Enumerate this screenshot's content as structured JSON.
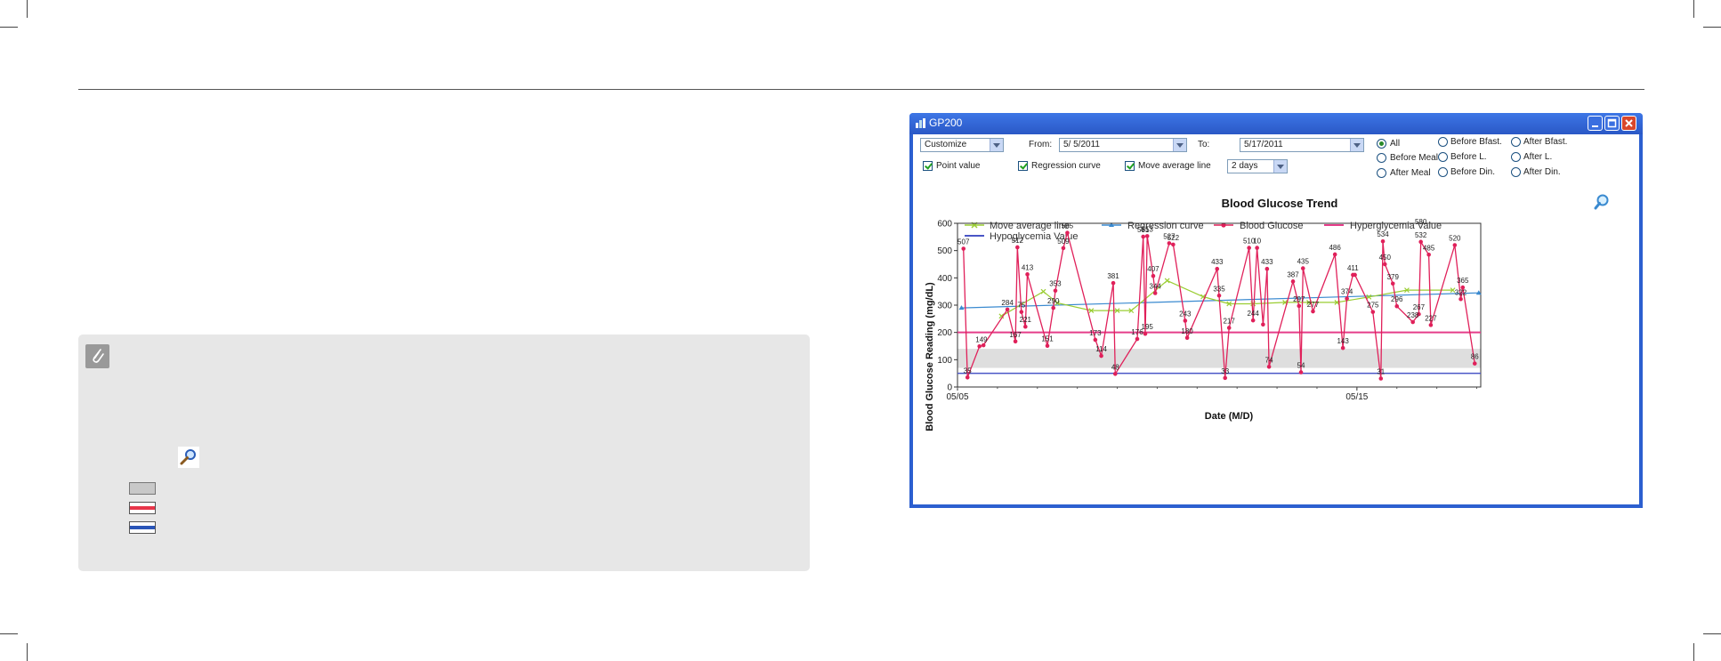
{
  "window": {
    "title": "GP200",
    "range_select": "Customize",
    "from_label": "From:",
    "from_date": "5/ 5/2011",
    "to_label": "To:",
    "to_date": "5/17/2011",
    "checkboxes": {
      "point_value": "Point value",
      "regression_curve": "Regression curve",
      "move_average_line": "Move average line"
    },
    "interval_select": "2 days",
    "meal_filters": [
      "All",
      "Before Bfast.",
      "After Bfast.",
      "Before Meal",
      "Before L.",
      "After L.",
      "After Meal",
      "Before Din.",
      "After Din."
    ],
    "selected_filter": "All"
  },
  "chart_data": {
    "type": "line",
    "title": "Blood Glucose Trend",
    "xlabel": "Date (M/D)",
    "ylabel": "Blood Glucose Reading (mg/dL)",
    "ylim": [
      0,
      600
    ],
    "yticks": [
      "0",
      "100",
      "200",
      "300",
      "400",
      "500",
      "600"
    ],
    "xticks": [
      {
        "label": "05/05",
        "day": 5
      },
      {
        "label": "05/15",
        "day": 15
      }
    ],
    "xlim_days": [
      5,
      18.1
    ],
    "legend": [
      "Move average line",
      "Regression curve",
      "Blood Glucose",
      "Hyperglycemia Value",
      "Hypoglycemia Value"
    ],
    "hyperglycemia_value": 200,
    "hypoglycemia_value": 50,
    "target_band": [
      70,
      140
    ],
    "colors": {
      "glucose": "#e0205a",
      "moving_average": "#9acd32",
      "regression": "#3a8ad0",
      "hyper": "#e53d8a",
      "hypo": "#4a56c6",
      "band": "#dedede"
    },
    "series": [
      {
        "name": "Blood Glucose",
        "points": [
          [
            5.15,
            507
          ],
          [
            5.25,
            35
          ],
          [
            5.55,
            149
          ],
          [
            5.65,
            153
          ],
          [
            6.25,
            284
          ],
          [
            6.45,
            167
          ],
          [
            6.5,
            512
          ],
          [
            6.6,
            275
          ],
          [
            6.7,
            221
          ],
          [
            6.75,
            413
          ],
          [
            7.25,
            151
          ],
          [
            7.4,
            290
          ],
          [
            7.45,
            353
          ],
          [
            7.65,
            509
          ],
          [
            7.75,
            565
          ],
          [
            8.45,
            173
          ],
          [
            8.6,
            114
          ],
          [
            8.9,
            381
          ],
          [
            8.95,
            48
          ],
          [
            9.5,
            176
          ],
          [
            9.65,
            551
          ],
          [
            9.7,
            195
          ],
          [
            9.75,
            553
          ],
          [
            9.9,
            407
          ],
          [
            9.95,
            344
          ],
          [
            10.3,
            527
          ],
          [
            10.4,
            522
          ],
          [
            10.7,
            243
          ],
          [
            10.75,
            180
          ],
          [
            11.5,
            433
          ],
          [
            11.55,
            335
          ],
          [
            11.7,
            33
          ],
          [
            11.8,
            217
          ],
          [
            12.3,
            510
          ],
          [
            12.4,
            244
          ],
          [
            12.5,
            510
          ],
          [
            12.65,
            229
          ],
          [
            12.75,
            433
          ],
          [
            12.8,
            74
          ],
          [
            13.4,
            387
          ],
          [
            13.55,
            297
          ],
          [
            13.6,
            54
          ],
          [
            13.65,
            435
          ],
          [
            13.9,
            277
          ],
          [
            14.45,
            486
          ],
          [
            14.65,
            143
          ],
          [
            14.75,
            324
          ],
          [
            14.9,
            411
          ],
          [
            14.95,
            411
          ],
          [
            15.4,
            275
          ],
          [
            15.6,
            31
          ],
          [
            15.65,
            534
          ],
          [
            15.7,
            450
          ],
          [
            15.9,
            379
          ],
          [
            16.0,
            296
          ],
          [
            16.4,
            238
          ],
          [
            16.55,
            267
          ],
          [
            16.6,
            532
          ],
          [
            16.8,
            485
          ],
          [
            16.85,
            227
          ],
          [
            17.45,
            520
          ],
          [
            17.6,
            322
          ],
          [
            17.65,
            365
          ],
          [
            17.95,
            86
          ]
        ]
      },
      {
        "name": "Move average line",
        "points": [
          [
            6.1,
            260
          ],
          [
            7.15,
            350
          ],
          [
            7.5,
            308
          ],
          [
            8.35,
            280
          ],
          [
            9.0,
            280
          ],
          [
            9.35,
            280
          ],
          [
            10.25,
            390
          ],
          [
            11.15,
            331
          ],
          [
            11.8,
            305
          ],
          [
            12.4,
            305
          ],
          [
            13.2,
            310
          ],
          [
            13.8,
            310
          ],
          [
            14.5,
            310
          ],
          [
            15.3,
            330
          ],
          [
            16.25,
            355
          ],
          [
            17.4,
            355
          ]
        ]
      },
      {
        "name": "Regression curve",
        "points": [
          [
            5.1,
            290
          ],
          [
            18.05,
            345
          ]
        ]
      }
    ],
    "point_labels": [
      [
        "507",
        5.15,
        507
      ],
      [
        "35",
        5.25,
        35
      ],
      [
        "149",
        5.6,
        149
      ],
      [
        "284",
        6.25,
        284
      ],
      [
        "75",
        6.6,
        275
      ],
      [
        "167",
        6.45,
        167
      ],
      [
        "512",
        6.5,
        512
      ],
      [
        "221",
        6.7,
        221
      ],
      [
        "413",
        6.75,
        413
      ],
      [
        "151",
        7.25,
        151
      ],
      [
        "290",
        7.4,
        290
      ],
      [
        "353",
        7.45,
        353
      ],
      [
        "509",
        7.65,
        509
      ],
      [
        "565",
        7.75,
        565
      ],
      [
        "173",
        8.45,
        173
      ],
      [
        "114",
        8.6,
        114
      ],
      [
        "381",
        8.9,
        381
      ],
      [
        "48",
        8.95,
        48
      ],
      [
        "176",
        9.5,
        176
      ],
      [
        "551",
        9.65,
        551
      ],
      [
        "195",
        9.75,
        195
      ],
      [
        "553",
        9.75,
        553
      ],
      [
        "407",
        9.9,
        407
      ],
      [
        "344",
        9.95,
        344
      ],
      [
        "527",
        10.3,
        527
      ],
      [
        "522",
        10.4,
        522
      ],
      [
        "243",
        10.7,
        243
      ],
      [
        "180",
        10.75,
        180
      ],
      [
        "433",
        11.5,
        433
      ],
      [
        "335",
        11.55,
        335
      ],
      [
        "33",
        11.7,
        33
      ],
      [
        "217",
        11.8,
        217
      ],
      [
        "510",
        12.3,
        510
      ],
      [
        "244",
        12.4,
        244
      ],
      [
        "10",
        12.5,
        510
      ],
      [
        "433",
        12.75,
        433
      ],
      [
        "74",
        12.8,
        74
      ],
      [
        "387",
        13.4,
        387
      ],
      [
        "297",
        13.55,
        297
      ],
      [
        "54",
        13.6,
        54
      ],
      [
        "435",
        13.65,
        435
      ],
      [
        "277",
        13.9,
        277
      ],
      [
        "486",
        14.45,
        486
      ],
      [
        "143",
        14.65,
        143
      ],
      [
        "374",
        14.75,
        324
      ],
      [
        "411",
        14.9,
        411
      ],
      [
        "275",
        15.4,
        275
      ],
      [
        "31",
        15.6,
        31
      ],
      [
        "534",
        15.65,
        534
      ],
      [
        "450",
        15.7,
        450
      ],
      [
        "379",
        15.9,
        379
      ],
      [
        "296",
        16.0,
        296
      ],
      [
        "238",
        16.4,
        238
      ],
      [
        "267",
        16.55,
        267
      ],
      [
        "532",
        16.6,
        532
      ],
      [
        "580",
        16.6,
        580
      ],
      [
        "485",
        16.8,
        485
      ],
      [
        "227",
        16.85,
        227
      ],
      [
        "520",
        17.45,
        520
      ],
      [
        "322",
        17.6,
        322
      ],
      [
        "365",
        17.65,
        365
      ],
      [
        "86",
        17.95,
        86
      ]
    ]
  }
}
